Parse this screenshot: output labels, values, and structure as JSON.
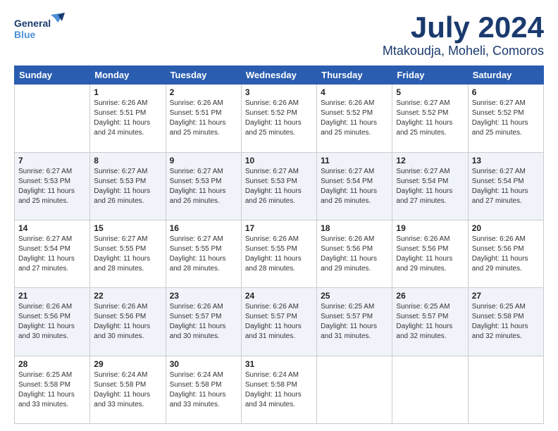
{
  "header": {
    "logo_general": "General",
    "logo_blue": "Blue",
    "month_title": "July 2024",
    "location": "Mtakoudja, Moheli, Comoros"
  },
  "days_of_week": [
    "Sunday",
    "Monday",
    "Tuesday",
    "Wednesday",
    "Thursday",
    "Friday",
    "Saturday"
  ],
  "weeks": [
    [
      {
        "day": "",
        "text": ""
      },
      {
        "day": "1",
        "text": "Sunrise: 6:26 AM\nSunset: 5:51 PM\nDaylight: 11 hours\nand 24 minutes."
      },
      {
        "day": "2",
        "text": "Sunrise: 6:26 AM\nSunset: 5:51 PM\nDaylight: 11 hours\nand 25 minutes."
      },
      {
        "day": "3",
        "text": "Sunrise: 6:26 AM\nSunset: 5:52 PM\nDaylight: 11 hours\nand 25 minutes."
      },
      {
        "day": "4",
        "text": "Sunrise: 6:26 AM\nSunset: 5:52 PM\nDaylight: 11 hours\nand 25 minutes."
      },
      {
        "day": "5",
        "text": "Sunrise: 6:27 AM\nSunset: 5:52 PM\nDaylight: 11 hours\nand 25 minutes."
      },
      {
        "day": "6",
        "text": "Sunrise: 6:27 AM\nSunset: 5:52 PM\nDaylight: 11 hours\nand 25 minutes."
      }
    ],
    [
      {
        "day": "7",
        "text": "Sunrise: 6:27 AM\nSunset: 5:53 PM\nDaylight: 11 hours\nand 25 minutes."
      },
      {
        "day": "8",
        "text": "Sunrise: 6:27 AM\nSunset: 5:53 PM\nDaylight: 11 hours\nand 26 minutes."
      },
      {
        "day": "9",
        "text": "Sunrise: 6:27 AM\nSunset: 5:53 PM\nDaylight: 11 hours\nand 26 minutes."
      },
      {
        "day": "10",
        "text": "Sunrise: 6:27 AM\nSunset: 5:53 PM\nDaylight: 11 hours\nand 26 minutes."
      },
      {
        "day": "11",
        "text": "Sunrise: 6:27 AM\nSunset: 5:54 PM\nDaylight: 11 hours\nand 26 minutes."
      },
      {
        "day": "12",
        "text": "Sunrise: 6:27 AM\nSunset: 5:54 PM\nDaylight: 11 hours\nand 27 minutes."
      },
      {
        "day": "13",
        "text": "Sunrise: 6:27 AM\nSunset: 5:54 PM\nDaylight: 11 hours\nand 27 minutes."
      }
    ],
    [
      {
        "day": "14",
        "text": "Sunrise: 6:27 AM\nSunset: 5:54 PM\nDaylight: 11 hours\nand 27 minutes."
      },
      {
        "day": "15",
        "text": "Sunrise: 6:27 AM\nSunset: 5:55 PM\nDaylight: 11 hours\nand 28 minutes."
      },
      {
        "day": "16",
        "text": "Sunrise: 6:27 AM\nSunset: 5:55 PM\nDaylight: 11 hours\nand 28 minutes."
      },
      {
        "day": "17",
        "text": "Sunrise: 6:26 AM\nSunset: 5:55 PM\nDaylight: 11 hours\nand 28 minutes."
      },
      {
        "day": "18",
        "text": "Sunrise: 6:26 AM\nSunset: 5:56 PM\nDaylight: 11 hours\nand 29 minutes."
      },
      {
        "day": "19",
        "text": "Sunrise: 6:26 AM\nSunset: 5:56 PM\nDaylight: 11 hours\nand 29 minutes."
      },
      {
        "day": "20",
        "text": "Sunrise: 6:26 AM\nSunset: 5:56 PM\nDaylight: 11 hours\nand 29 minutes."
      }
    ],
    [
      {
        "day": "21",
        "text": "Sunrise: 6:26 AM\nSunset: 5:56 PM\nDaylight: 11 hours\nand 30 minutes."
      },
      {
        "day": "22",
        "text": "Sunrise: 6:26 AM\nSunset: 5:56 PM\nDaylight: 11 hours\nand 30 minutes."
      },
      {
        "day": "23",
        "text": "Sunrise: 6:26 AM\nSunset: 5:57 PM\nDaylight: 11 hours\nand 30 minutes."
      },
      {
        "day": "24",
        "text": "Sunrise: 6:26 AM\nSunset: 5:57 PM\nDaylight: 11 hours\nand 31 minutes."
      },
      {
        "day": "25",
        "text": "Sunrise: 6:25 AM\nSunset: 5:57 PM\nDaylight: 11 hours\nand 31 minutes."
      },
      {
        "day": "26",
        "text": "Sunrise: 6:25 AM\nSunset: 5:57 PM\nDaylight: 11 hours\nand 32 minutes."
      },
      {
        "day": "27",
        "text": "Sunrise: 6:25 AM\nSunset: 5:58 PM\nDaylight: 11 hours\nand 32 minutes."
      }
    ],
    [
      {
        "day": "28",
        "text": "Sunrise: 6:25 AM\nSunset: 5:58 PM\nDaylight: 11 hours\nand 33 minutes."
      },
      {
        "day": "29",
        "text": "Sunrise: 6:24 AM\nSunset: 5:58 PM\nDaylight: 11 hours\nand 33 minutes."
      },
      {
        "day": "30",
        "text": "Sunrise: 6:24 AM\nSunset: 5:58 PM\nDaylight: 11 hours\nand 33 minutes."
      },
      {
        "day": "31",
        "text": "Sunrise: 6:24 AM\nSunset: 5:58 PM\nDaylight: 11 hours\nand 34 minutes."
      },
      {
        "day": "",
        "text": ""
      },
      {
        "day": "",
        "text": ""
      },
      {
        "day": "",
        "text": ""
      }
    ]
  ]
}
